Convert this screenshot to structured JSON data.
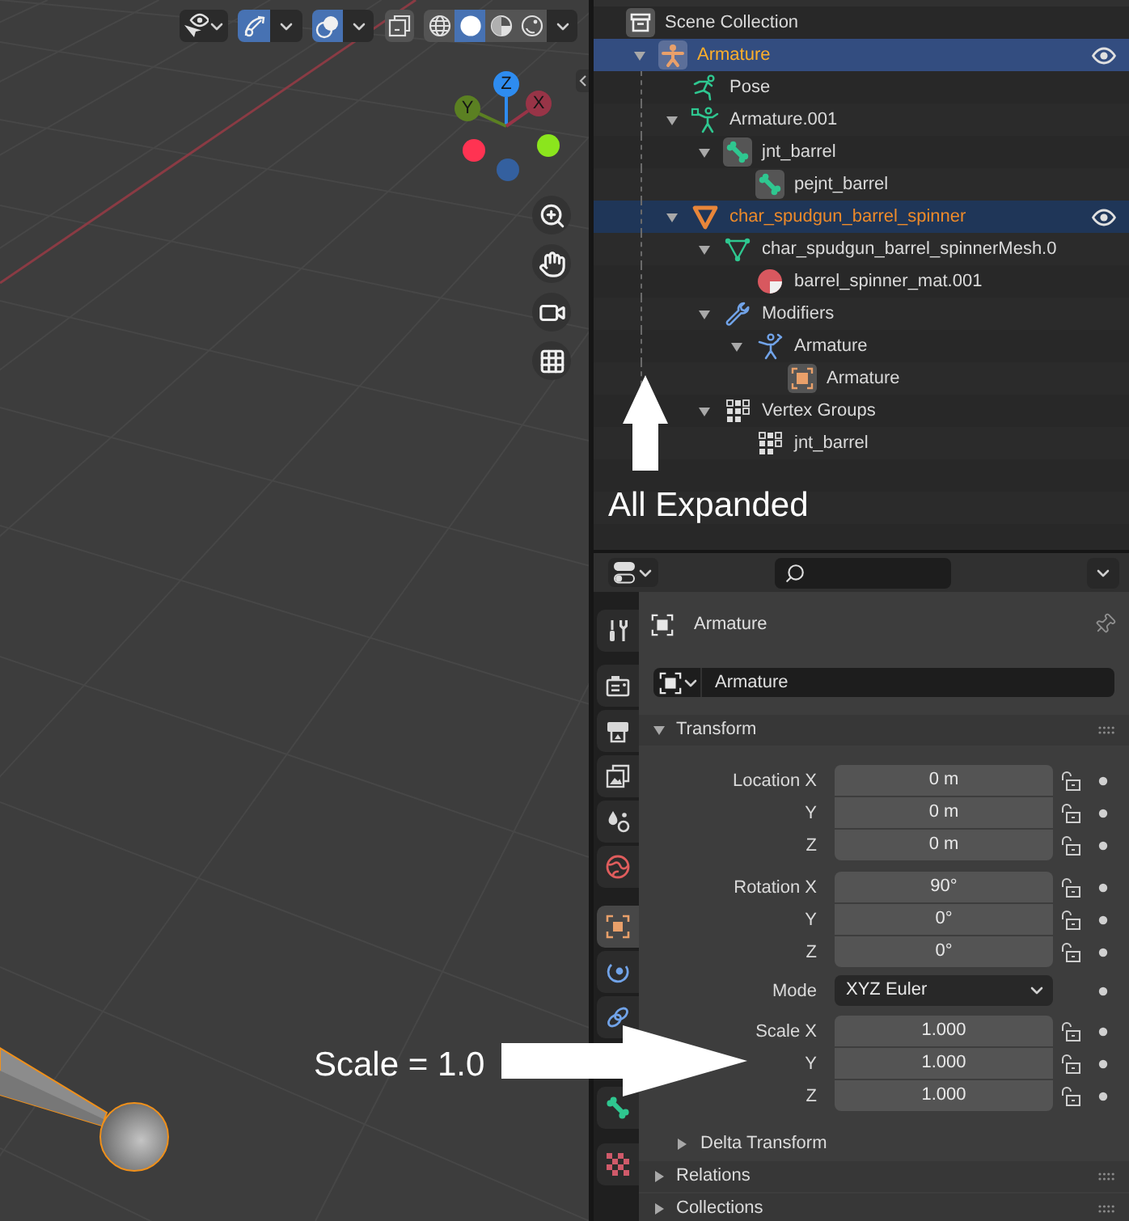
{
  "viewport": {
    "header": {
      "gizmos": {
        "on": true
      },
      "overlays": {
        "on": true
      },
      "xray": {
        "on": false
      },
      "shading": [
        {
          "kind": "wireframe",
          "selected": false
        },
        {
          "kind": "solid",
          "selected": true
        },
        {
          "kind": "material",
          "selected": false
        },
        {
          "kind": "rendered",
          "selected": false
        }
      ]
    },
    "gizmo": [
      {
        "kind": "axis",
        "label": "Z",
        "color": "#2e8cf0"
      },
      {
        "kind": "axis",
        "label": "Y",
        "color": "#5b8022"
      },
      {
        "kind": "axis",
        "label": "X",
        "color": "#983447"
      },
      {
        "kind": "dot",
        "color": "#34609f"
      },
      {
        "kind": "dot",
        "color": "#8be51d"
      },
      {
        "kind": "dot",
        "color": "#ff3352"
      }
    ],
    "annotation": "Scale = 1.0"
  },
  "outliner": {
    "tree": [
      {
        "label": "Scene Collection",
        "kind": "collection",
        "selected": false,
        "active": false,
        "children": [
          {
            "label": "Armature",
            "kind": "armature_object",
            "selected": true,
            "active": true,
            "expanded": true,
            "visible": true,
            "children": [
              {
                "label": "Pose",
                "kind": "pose",
                "selected": false,
                "active": false
              },
              {
                "label": "Armature.001",
                "kind": "armature_data",
                "selected": false,
                "active": false,
                "expanded": true,
                "children": [
                  {
                    "label": "jnt_barrel",
                    "kind": "bone",
                    "selected": false,
                    "active": false,
                    "expanded": true,
                    "children": [
                      {
                        "label": "pejnt_barrel",
                        "kind": "bone",
                        "selected": false,
                        "active": false
                      }
                    ]
                  }
                ]
              },
              {
                "label": "char_spudgun_barrel_spinner",
                "kind": "mesh_object",
                "selected": true,
                "active": false,
                "expanded": true,
                "visible": true,
                "children": [
                  {
                    "label": "char_spudgun_barrel_spinnerMesh.0",
                    "kind": "mesh_data",
                    "selected": false,
                    "active": false,
                    "expanded": true,
                    "children": [
                      {
                        "label": "barrel_spinner_mat.001",
                        "kind": "material",
                        "selected": false,
                        "active": false
                      }
                    ]
                  },
                  {
                    "label": "Modifiers",
                    "kind": "modifiers",
                    "selected": false,
                    "active": false,
                    "expanded": true,
                    "children": [
                      {
                        "label": "Armature",
                        "kind": "armature_modifier",
                        "selected": false,
                        "active": false,
                        "expanded": true,
                        "children": [
                          {
                            "label": "Armature",
                            "kind": "object",
                            "selected": false,
                            "active": false
                          }
                        ]
                      }
                    ]
                  },
                  {
                    "label": "Vertex Groups",
                    "kind": "vertex_group",
                    "selected": false,
                    "active": false,
                    "expanded": true,
                    "children": [
                      {
                        "label": "jnt_barrel",
                        "kind": "vertex_group",
                        "selected": false,
                        "active": false
                      }
                    ]
                  }
                ]
              }
            ]
          }
        ]
      }
    ],
    "annotation": "All Expanded"
  },
  "properties": {
    "tabs": [
      {
        "kind": "tool",
        "selected": false
      },
      {
        "kind": "render",
        "selected": false
      },
      {
        "kind": "output",
        "selected": false
      },
      {
        "kind": "view_layer",
        "selected": false
      },
      {
        "kind": "scene",
        "selected": false
      },
      {
        "kind": "world",
        "selected": false
      },
      {
        "kind": "object",
        "selected": true
      },
      {
        "kind": "physics",
        "selected": false
      },
      {
        "kind": "constraints",
        "selected": false
      },
      {
        "kind": "bone",
        "selected": false
      },
      {
        "kind": "texture",
        "selected": false
      }
    ],
    "title": "Armature",
    "name_field": {
      "value": "Armature"
    },
    "panels": [
      {
        "title": "Transform",
        "expanded": true,
        "groups": [
          {
            "kind": "vector",
            "rows": [
              {
                "label": "Location X",
                "value": "0 m",
                "locked": false
              },
              {
                "label": "Y",
                "value": "0 m",
                "locked": false
              },
              {
                "label": "Z",
                "value": "0 m",
                "locked": false
              }
            ]
          },
          {
            "kind": "vector",
            "rows": [
              {
                "label": "Rotation X",
                "value": "90°",
                "locked": false
              },
              {
                "label": "Y",
                "value": "0°",
                "locked": false
              },
              {
                "label": "Z",
                "value": "0°",
                "locked": false
              }
            ]
          },
          {
            "kind": "dropdown",
            "label": "Mode",
            "value": "XYZ Euler"
          },
          {
            "kind": "vector",
            "rows": [
              {
                "label": "Scale X",
                "value": "1.000",
                "locked": false
              },
              {
                "label": "Y",
                "value": "1.000",
                "locked": false
              },
              {
                "label": "Z",
                "value": "1.000",
                "locked": false
              }
            ]
          }
        ],
        "subpanels": [
          {
            "title": "Delta Transform",
            "expanded": false
          }
        ]
      },
      {
        "title": "Relations",
        "expanded": false
      },
      {
        "title": "Collections",
        "expanded": false
      }
    ]
  }
}
